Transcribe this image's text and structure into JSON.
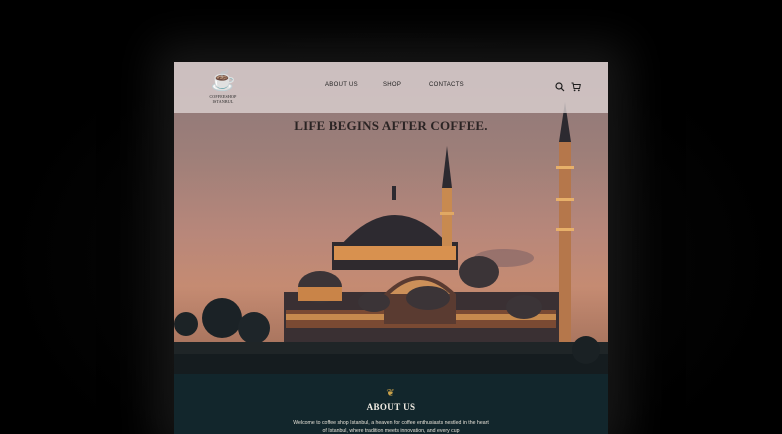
{
  "logo": {
    "icon": "coffee-cup-icon",
    "name": "COFFEESHOP ISTANBUL"
  },
  "nav": {
    "items": [
      "ABOUT US",
      "SHOP",
      "CONTACTS"
    ],
    "search_icon": "search-icon",
    "cart_icon": "cart-icon"
  },
  "hero": {
    "headline": "LIFE BEGINS AFTER COFFEE."
  },
  "about": {
    "icon": "coffee-bean-icon",
    "heading": "ABOUT US",
    "text": "Welcome to coffee shop Istanbul, a heaven for coffee enthusiasts nestled in the heart of Istanbul, where tradition meets innovation, and every cup"
  },
  "colors": {
    "nav_bg": "#ded4d4",
    "about_bg": "#12262c",
    "accent": "#c9a14a"
  }
}
